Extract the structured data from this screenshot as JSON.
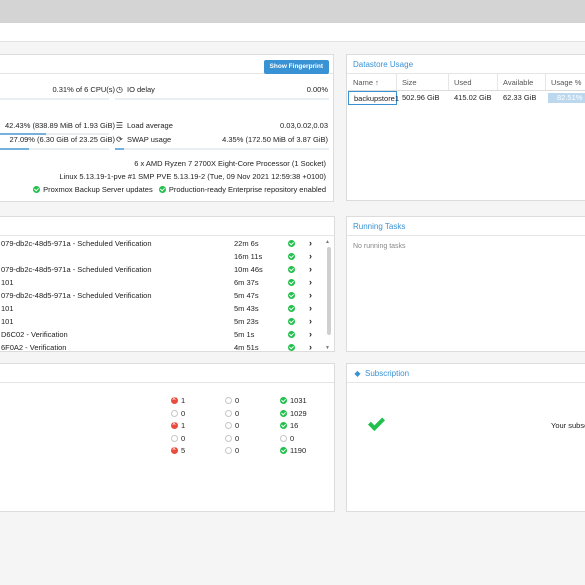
{
  "status": {
    "fingerprint_button": "Show Fingerprint",
    "cpu_value": "0.31% of 6 CPU(s)",
    "io_delay_label": "IO delay",
    "io_delay_value": "0.00%",
    "mem_value": "42.43% (838.89 MiB of 1.93 GiB)",
    "load_label": "Load average",
    "load_value": "0.03,0.02,0.03",
    "root_value": "27.09% (6.30 GiB of 23.25 GiB)",
    "swap_label": "SWAP usage",
    "swap_value": "4.35% (172.50 MiB of 3.87 GiB)",
    "cpu_model": "6 x AMD Ryzen 7 2700X Eight-Core Processor (1 Socket)",
    "kernel": "Linux 5.13.19-1-pve #1 SMP PVE 5.13.19-2 (Tue, 09 Nov 2021 12:59:38 +0100)",
    "repo_updates": "Proxmox Backup Server updates",
    "repo_enterprise": "Production-ready Enterprise repository enabled",
    "bars": {
      "cpu": 0.0031,
      "io": 0.0,
      "mem": 0.4243,
      "root": 0.2709,
      "swap": 0.0435
    }
  },
  "datastore": {
    "title": "Datastore Usage",
    "columns": [
      "Name ↑",
      "Size",
      "Used",
      "Available",
      "Usage %"
    ],
    "rows": [
      {
        "name": "backupstore1",
        "size": "502.96 GiB",
        "used": "415.02 GiB",
        "available": "62.33 GiB",
        "usage": "82.51%"
      }
    ]
  },
  "tasks": {
    "rows": [
      {
        "name": "079-db2c-48d5-971a - Scheduled Verification",
        "duration": "22m 6s"
      },
      {
        "name": "",
        "duration": "16m 11s"
      },
      {
        "name": "079-db2c-48d5-971a - Scheduled Verification",
        "duration": "10m 46s"
      },
      {
        "name": "101",
        "duration": "6m 37s"
      },
      {
        "name": "079-db2c-48d5-971a - Scheduled Verification",
        "duration": "5m 47s"
      },
      {
        "name": "101",
        "duration": "5m 43s"
      },
      {
        "name": "101",
        "duration": "5m 23s"
      },
      {
        "name": "D6C02 - Verification",
        "duration": "5m 1s"
      },
      {
        "name": "6F0A2 - Verification",
        "duration": "4m 51s"
      }
    ]
  },
  "running": {
    "title": "Running Tasks",
    "empty_text": "No running tasks"
  },
  "jobs": {
    "rows": [
      {
        "errors": "1",
        "warnings": "0",
        "ok": "1031"
      },
      {
        "errors": "0",
        "warnings": "0",
        "ok": "1029"
      },
      {
        "errors": "1",
        "warnings": "0",
        "ok": "16"
      },
      {
        "errors": "0",
        "warnings": "0",
        "ok": "0"
      },
      {
        "errors": "5",
        "warnings": "0",
        "ok": "1190"
      }
    ]
  },
  "subscription": {
    "title": "Subscription",
    "text": "Your subsc"
  },
  "colors": {
    "accent": "#3892d4",
    "ok": "#21bf4b",
    "error": "#e74c3c"
  }
}
